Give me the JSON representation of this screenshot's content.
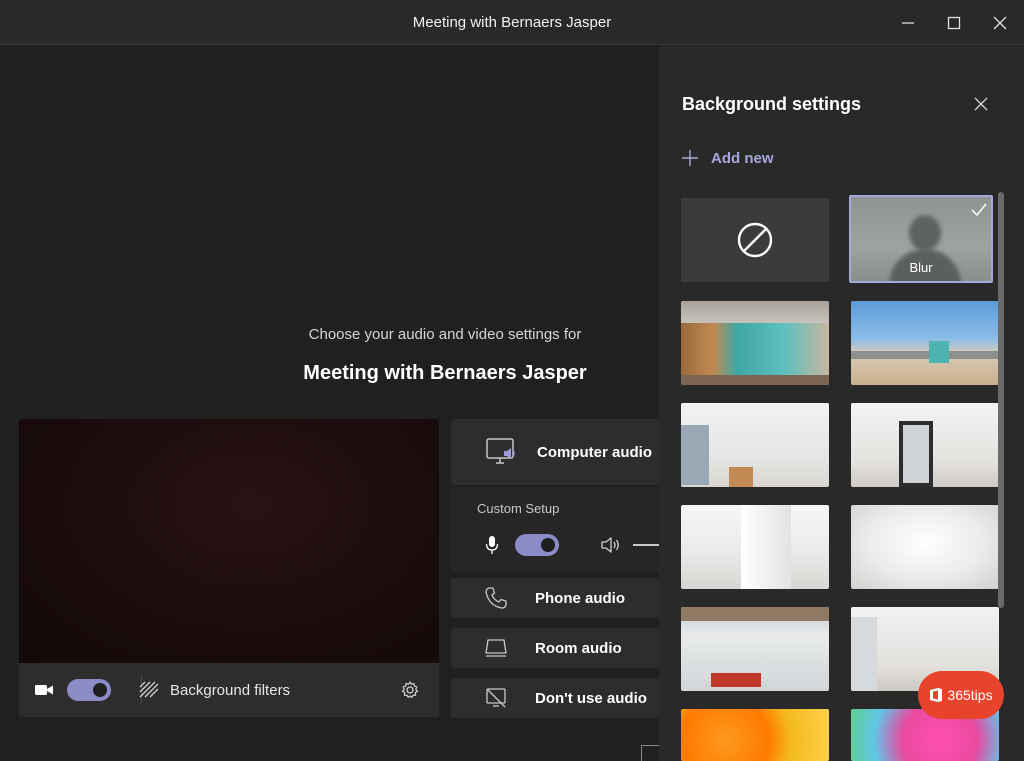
{
  "window": {
    "title": "Meeting with Bernaers Jasper",
    "controls": [
      "minimize-icon",
      "maximize-icon",
      "close-icon"
    ]
  },
  "prejoin": {
    "choose_text": "Choose your audio and video settings for",
    "meeting_title": "Meeting with Bernaers Jasper",
    "video": {
      "camera_toggle_on": true,
      "background_filters_label": "Background filters"
    },
    "audio": {
      "computer_audio": "Computer audio",
      "custom_setup": "Custom Setup",
      "mic_toggle_on": true,
      "phone_audio": "Phone audio",
      "room_audio": "Room audio",
      "dont_use_audio": "Don't use audio"
    }
  },
  "background_settings": {
    "title": "Background settings",
    "add_new": "Add new",
    "selected": "Blur",
    "tiles": [
      {
        "id": "none",
        "label": ""
      },
      {
        "id": "blur",
        "label": "Blur"
      },
      {
        "id": "office-lockers",
        "label": ""
      },
      {
        "id": "beach-lifeguard",
        "label": ""
      },
      {
        "id": "white-room-1",
        "label": ""
      },
      {
        "id": "white-room-mirror",
        "label": ""
      },
      {
        "id": "white-loft",
        "label": ""
      },
      {
        "id": "white-studio",
        "label": ""
      },
      {
        "id": "office-windows",
        "label": ""
      },
      {
        "id": "white-room-2",
        "label": ""
      },
      {
        "id": "orange-balls",
        "label": ""
      },
      {
        "id": "pink-balls",
        "label": ""
      }
    ]
  },
  "watermark": {
    "text": "365tips"
  },
  "colors": {
    "accent": "#8b8cc7",
    "accent_text": "#a6a7dc",
    "background": "#1f1f1f",
    "panel": "#292929",
    "card": "#2d2d2d",
    "badge": "#e8432b"
  }
}
